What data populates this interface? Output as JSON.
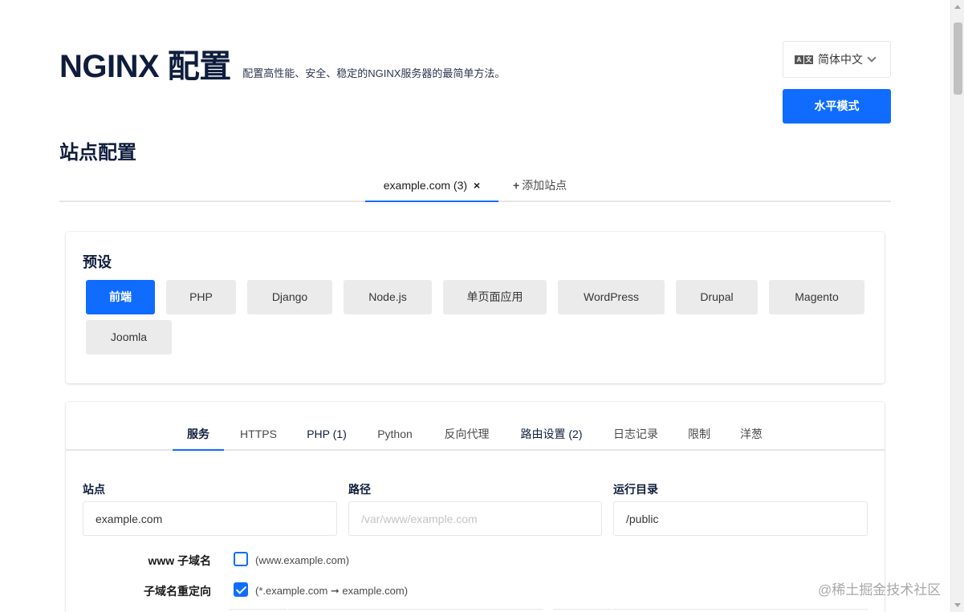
{
  "header": {
    "title": "NGINX 配置",
    "subtitle": "配置高性能、安全、稳定的NGINX服务器的最简单方法。"
  },
  "language": {
    "selected": "简体中文",
    "icon": "translate-icon"
  },
  "mode_button": "水平模式",
  "sites": {
    "section_title": "站点配置",
    "tabs": [
      {
        "label": "example.com (3)",
        "close": "×",
        "active": true
      }
    ],
    "add_label": "添加站点",
    "add_symbol": "+"
  },
  "presets": {
    "title": "预设",
    "items": [
      {
        "label": "前端",
        "active": true
      },
      {
        "label": "PHP",
        "active": false
      },
      {
        "label": "Django",
        "active": false
      },
      {
        "label": "Node.js",
        "active": false
      },
      {
        "label": "单页面应用",
        "active": false
      },
      {
        "label": "WordPress",
        "active": false
      },
      {
        "label": "Drupal",
        "active": false
      },
      {
        "label": "Magento",
        "active": false
      },
      {
        "label": "Joomla",
        "active": false
      }
    ]
  },
  "service": {
    "tabs": [
      {
        "label": "服务",
        "active": true
      },
      {
        "label": "HTTPS"
      },
      {
        "label": "PHP (1)"
      },
      {
        "label": "Python"
      },
      {
        "label": "反向代理"
      },
      {
        "label": "路由设置 (2)"
      },
      {
        "label": "日志记录"
      },
      {
        "label": "限制"
      },
      {
        "label": "洋葱"
      }
    ],
    "fields": {
      "site_label": "站点",
      "site_value": "example.com",
      "path_label": "路径",
      "path_placeholder": "/var/www/example.com",
      "root_label": "运行目录",
      "root_value": "/public"
    },
    "www_label": "www 子域名",
    "www_hint": "(www.example.com)",
    "www_checked": false,
    "redirect_label": "子域名重定向",
    "redirect_hint": "(*.example.com ➞ example.com)",
    "redirect_checked": true
  },
  "watermark": "@稀土掘金技术社区",
  "colors": {
    "accent": "#0f6cff",
    "heading": "#0f1d3d",
    "preset_bg": "#ebebeb"
  }
}
